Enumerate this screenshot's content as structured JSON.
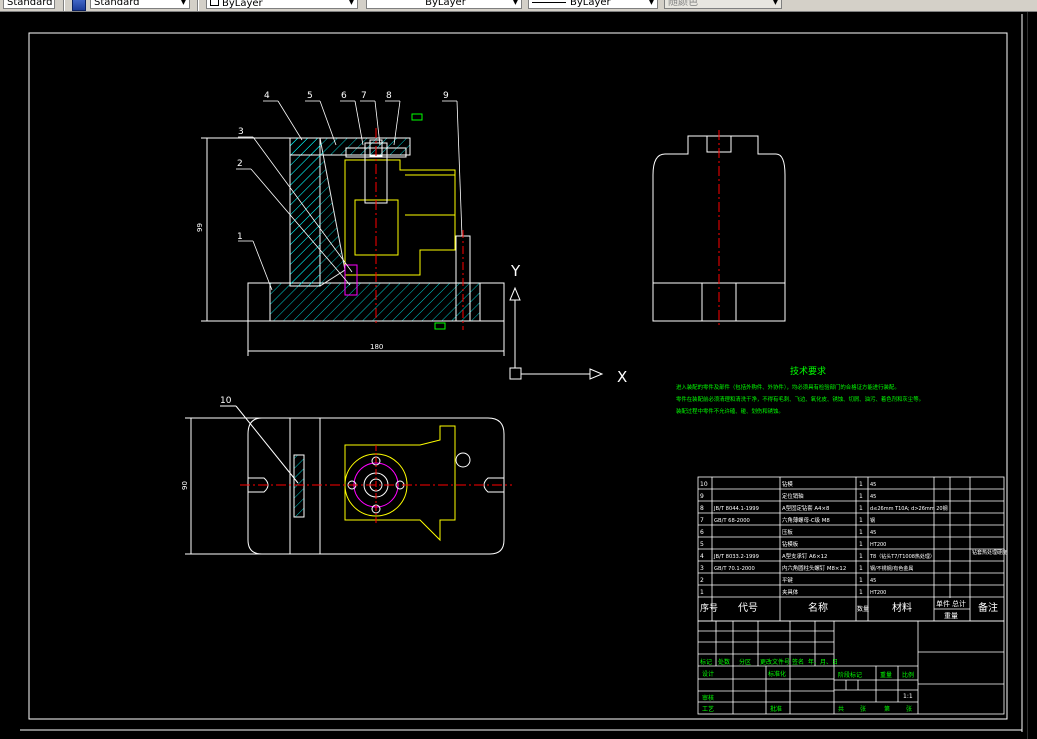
{
  "toolbar": {
    "textstyle_value": "Standard",
    "layer_value": "ByLayer",
    "linetype_value": "ByLayer",
    "lineweight_value": "ByLayer",
    "plotstyle_value": "随颜色"
  },
  "colors": {
    "background": "#000000",
    "frame": "#ffffff",
    "part": "#ffffff",
    "hatch": "#00ffff",
    "yellow": "#ffff00",
    "red": "#ff0000",
    "magenta": "#ff00ff",
    "green": "#00ff00"
  },
  "balloons": [
    "1",
    "2",
    "3",
    "4",
    "5",
    "6",
    "7",
    "8",
    "9",
    "10"
  ],
  "dimensions": {
    "height": "99",
    "length": "180",
    "width": "90"
  },
  "ucs": {
    "x_label": "X",
    "y_label": "Y"
  },
  "tech_requirements": {
    "title": "技术要求",
    "lines": [
      "进入装配的零件及部件（包括外购件、外协件），均必须具有检验部门的合格证方能进行装配。",
      "零件在装配前必须清理和清洗干净，不得有毛刺、飞边、氧化皮、锈蚀、切屑、油污、着色剂和灰尘等。",
      "装配过程中零件不允许磕、碰、划伤和锈蚀。"
    ]
  },
  "bom": {
    "rows": [
      {
        "no": "10",
        "code": "",
        "name": "钻模",
        "qty": "1",
        "material": "45"
      },
      {
        "no": "9",
        "code": "",
        "name": "定位销轴",
        "qty": "1",
        "material": "45"
      },
      {
        "no": "8",
        "code": "JB/T 8044.1-1999",
        "name": "A型固定钻套 A4×8",
        "qty": "1",
        "material": "d≤26mm T10A; d>26mm 20钢"
      },
      {
        "no": "7",
        "code": "GB/T 68-2000",
        "name": "六角薄螺母-C级 M8",
        "qty": "1",
        "material": "钢"
      },
      {
        "no": "6",
        "code": "",
        "name": "压板",
        "qty": "1",
        "material": "45"
      },
      {
        "no": "5",
        "code": "",
        "name": "钻模板",
        "qty": "1",
        "material": "HT200"
      },
      {
        "no": "4",
        "code": "JB/T 8033.2-1999",
        "name": "A型支承钉 A6×12",
        "qty": "1",
        "material": "T8（钻头T7/T1008热处理）"
      },
      {
        "no": "3",
        "code": "GB/T 70.1-2000",
        "name": "内六角圆柱头螺钉 M8×12",
        "qty": "1",
        "material": "钢/不锈钢/有色金属"
      },
      {
        "no": "2",
        "code": "",
        "name": "平键",
        "qty": "1",
        "material": "45"
      },
      {
        "no": "1",
        "code": "",
        "name": "夹具体",
        "qty": "1",
        "material": "HT200"
      }
    ],
    "note_4": "钻套热处理硬度",
    "header": {
      "no": "序号",
      "code": "代号",
      "name": "名称",
      "qty": "数量",
      "material": "材料",
      "single": "单件",
      "total": "总计",
      "weight": "重量",
      "remark": "备注"
    }
  },
  "title_block": {
    "revision_row": [
      "标记",
      "处数",
      "分区",
      "更改文件号",
      "签名",
      "年、月、日"
    ],
    "design": "设计",
    "standardization": "标准化",
    "stage_mark": "阶段标记",
    "weight": "重量",
    "scale": "比例",
    "scale_value": "1:1",
    "review": "审核",
    "process": "工艺",
    "approve": "批准",
    "sheets": [
      "共",
      "张",
      "第",
      "张"
    ]
  }
}
